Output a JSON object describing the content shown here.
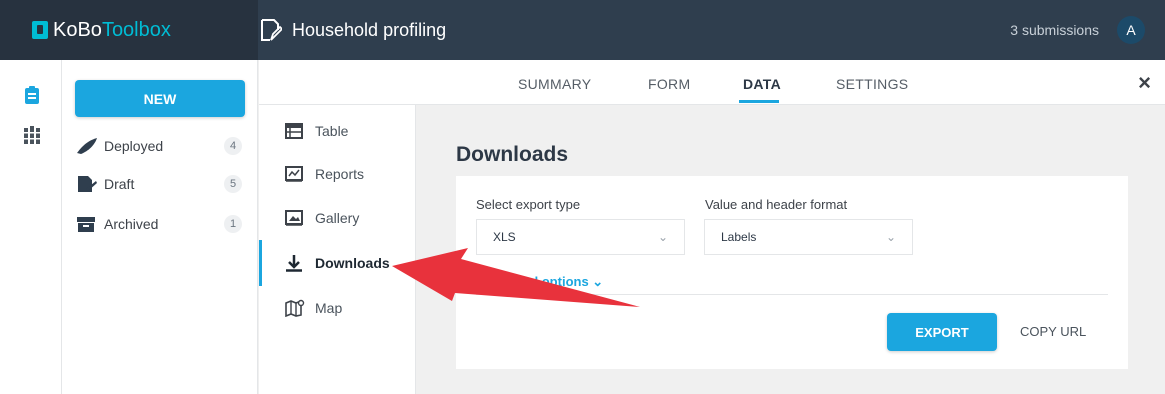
{
  "header": {
    "logo_ko": "KoBo",
    "logo_toolbox": "Toolbox",
    "form_title": "Household profiling",
    "submissions": "3 submissions",
    "avatar_letter": "A"
  },
  "sidebar": {
    "new_label": "NEW",
    "items": [
      {
        "label": "Deployed",
        "count": "4",
        "icon": "rocket-icon"
      },
      {
        "label": "Draft",
        "count": "5",
        "icon": "draft-icon"
      },
      {
        "label": "Archived",
        "count": "1",
        "icon": "archive-icon"
      }
    ]
  },
  "tabs": [
    {
      "label": "SUMMARY"
    },
    {
      "label": "FORM"
    },
    {
      "label": "DATA",
      "active": true
    },
    {
      "label": "SETTINGS"
    }
  ],
  "close_icon": "×",
  "datanav": {
    "items": [
      {
        "label": "Table",
        "icon": "table-icon"
      },
      {
        "label": "Reports",
        "icon": "reports-icon"
      },
      {
        "label": "Gallery",
        "icon": "gallery-icon"
      },
      {
        "label": "Downloads",
        "icon": "download-icon",
        "active": true
      },
      {
        "label": "Map",
        "icon": "map-icon"
      }
    ]
  },
  "downloads": {
    "title": "Downloads",
    "export_type_label": "Select export type",
    "export_type_value": "XLS",
    "format_label": "Value and header format",
    "format_value": "Labels",
    "advanced_label": "Advanced options",
    "export_button": "EXPORT",
    "copy_url_button": "COPY URL"
  },
  "colors": {
    "accent": "#1ba6df",
    "topbar": "#2f3e4e",
    "annotation_arrow": "#e8323c"
  }
}
